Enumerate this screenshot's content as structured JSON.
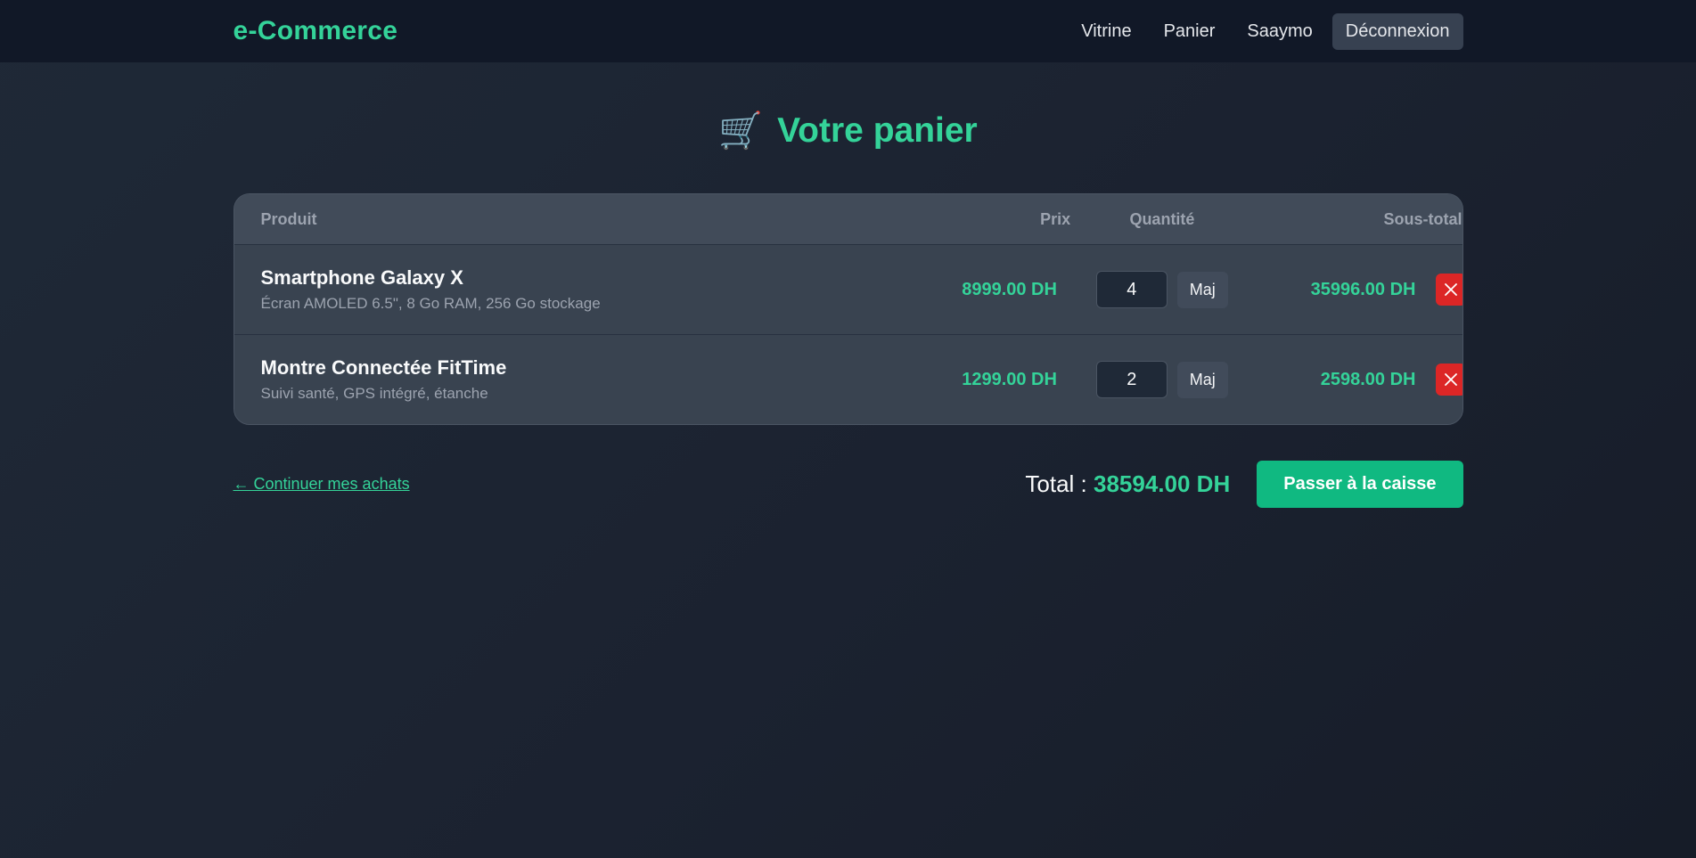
{
  "brand": "e-Commerce",
  "nav": {
    "vitrine": "Vitrine",
    "panier": "Panier",
    "user": "Saaymo",
    "logout": "Déconnexion"
  },
  "page": {
    "title": "Votre panier",
    "cart_emoji": "🛒"
  },
  "table": {
    "headers": {
      "product": "Produit",
      "price": "Prix",
      "quantity": "Quantité",
      "subtotal": "Sous-total"
    },
    "update_label": "Maj",
    "items": [
      {
        "name": "Smartphone Galaxy X",
        "description": "Écran AMOLED 6.5\", 8 Go RAM, 256 Go stockage",
        "price": "8999.00 DH",
        "quantity": "4",
        "subtotal": "35996.00 DH"
      },
      {
        "name": "Montre Connectée FitTime",
        "description": "Suivi santé, GPS intégré, étanche",
        "price": "1299.00 DH",
        "quantity": "2",
        "subtotal": "2598.00 DH"
      }
    ]
  },
  "footer": {
    "continue": "← Continuer mes achats",
    "total_label": "Total :",
    "total_value": "38594.00 DH",
    "checkout": "Passer à la caisse"
  },
  "colors": {
    "accent": "#34d399",
    "danger": "#dc2626",
    "checkout": "#10b981",
    "navbar": "#111827"
  }
}
